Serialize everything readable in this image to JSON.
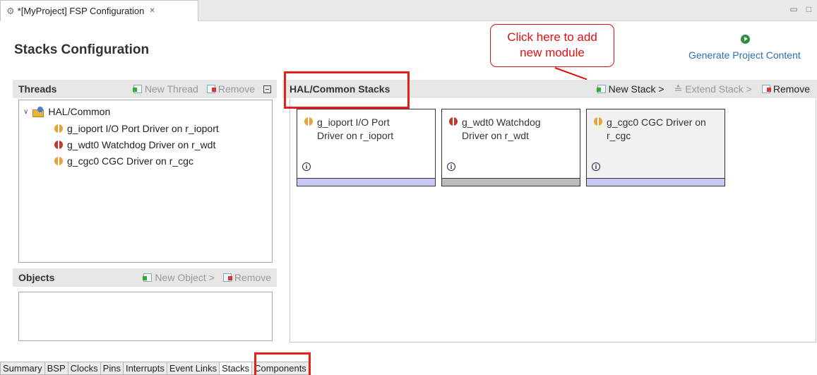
{
  "editor": {
    "tab_title": "*[MyProject] FSP Configuration",
    "close_glyph": "✕",
    "page_title": "Stacks Configuration",
    "generate_label": "Generate Project Content"
  },
  "callout": {
    "line1": "Click here to add",
    "line2": "new module",
    "color": "#e2211c"
  },
  "threads": {
    "title": "Threads",
    "new_thread": "New Thread",
    "remove": "Remove",
    "tree": {
      "root": "HAL/Common",
      "items": [
        "g_ioport I/O Port Driver on r_ioport",
        "g_wdt0 Watchdog Driver on r_wdt",
        "g_cgc0 CGC Driver on r_cgc"
      ]
    }
  },
  "objects": {
    "title": "Objects",
    "new_object": "New Object >",
    "remove": "Remove"
  },
  "stacks": {
    "title": "HAL/Common Stacks",
    "new_stack": "New Stack >",
    "extend_stack": "Extend Stack >",
    "remove": "Remove",
    "cards": [
      {
        "line1": "g_ioport I/O Port",
        "line2": "Driver on r_ioport",
        "bar_color": "#c8c8f8",
        "info": "i"
      },
      {
        "line1": "g_wdt0 Watchdog",
        "line2": "Driver on r_wdt",
        "bar_color": "#bcbcbc",
        "info": "i"
      },
      {
        "line1": "g_cgc0 CGC Driver on",
        "line2": "r_cgc",
        "bar_color": "#c8c8f8",
        "info": "i"
      }
    ]
  },
  "bottom_tabs": [
    "Summary",
    "BSP",
    "Clocks",
    "Pins",
    "Interrupts",
    "Event Links",
    "Stacks",
    "Components"
  ],
  "active_tab": "Stacks"
}
